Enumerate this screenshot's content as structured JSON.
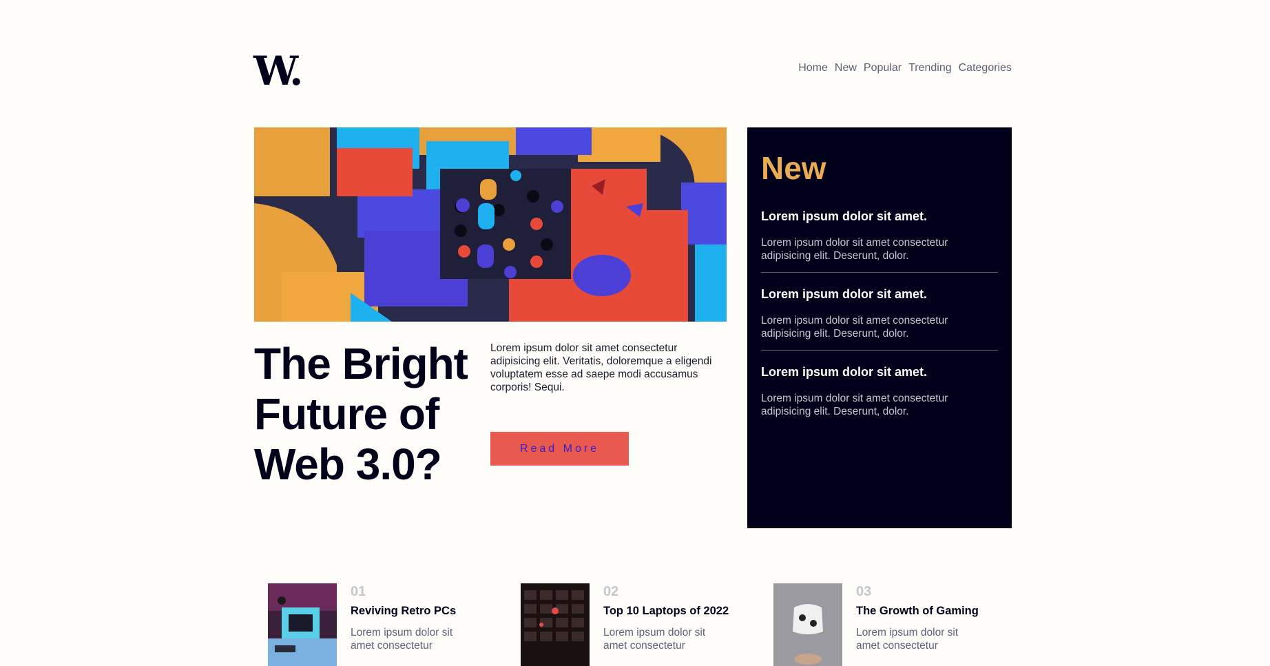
{
  "header": {
    "logo": "W.",
    "nav": [
      "Home",
      "New",
      "Popular",
      "Trending",
      "Categories"
    ]
  },
  "hero": {
    "title": "The Bright Future of Web 3.0?",
    "description": "Lorem ipsum dolor sit amet consectetur adipisicing elit. Veritatis, doloremque a eligendi voluptatem esse ad saepe modi accusamus corporis! Sequi.",
    "button": "Read More"
  },
  "new_panel": {
    "title": "New",
    "items": [
      {
        "title": "Lorem ipsum dolor sit amet.",
        "text": "Lorem ipsum dolor sit amet consectetur adipisicing elit. Deserunt, dolor."
      },
      {
        "title": "Lorem ipsum dolor sit amet.",
        "text": "Lorem ipsum dolor sit amet consectetur adipisicing elit. Deserunt, dolor."
      },
      {
        "title": "Lorem ipsum dolor sit amet.",
        "text": "Lorem ipsum dolor sit amet consectetur adipisicing elit. Deserunt, dolor."
      }
    ]
  },
  "cards": [
    {
      "num": "01",
      "title": "Reviving Retro PCs",
      "text": "Lorem ipsum dolor sit amet consectetur"
    },
    {
      "num": "02",
      "title": "Top 10 Laptops of 2022",
      "text": "Lorem ipsum dolor sit amet consectetur"
    },
    {
      "num": "03",
      "title": "The Growth of Gaming",
      "text": "Lorem ipsum dolor sit amet consectetur"
    }
  ],
  "colors": {
    "background": "#fffdf9",
    "dark": "#00001a",
    "accent_orange": "#e9ab53",
    "accent_red": "#e85a4f",
    "muted": "#5d5f79"
  }
}
